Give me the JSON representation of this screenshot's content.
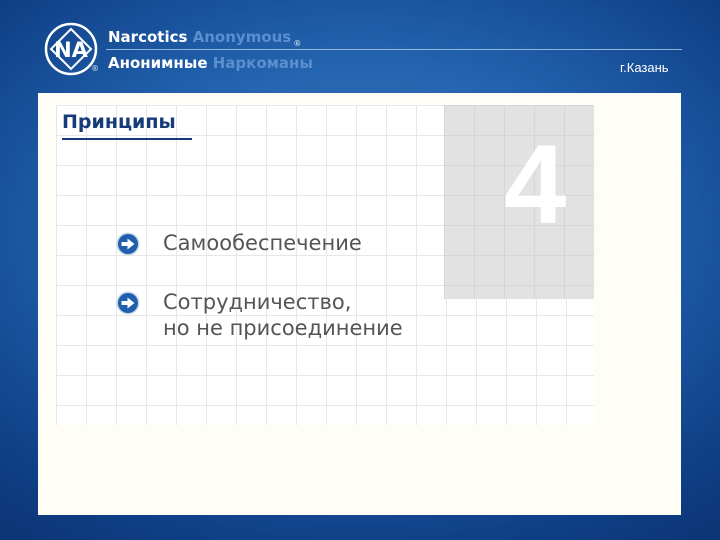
{
  "header": {
    "brand_en_bold": "Narcotics",
    "brand_en_light": "Anonymous",
    "brand_ru_bold": "Анонимные",
    "brand_ru_light": "Наркоманы",
    "registered_mark": "®",
    "logo_letters": "NA",
    "city": "г.Казань"
  },
  "slide": {
    "title": "Принципы",
    "number": "4",
    "items": [
      {
        "line1": "Самообеспечение",
        "line2": ""
      },
      {
        "line1": "Сотрудничество,",
        "line2": "но не присоединение"
      }
    ]
  },
  "colors": {
    "background_blue": "#1f5da8",
    "title_navy": "#163b7a",
    "bullet_blue": "#1f5fae",
    "panel": "#fefef7"
  }
}
